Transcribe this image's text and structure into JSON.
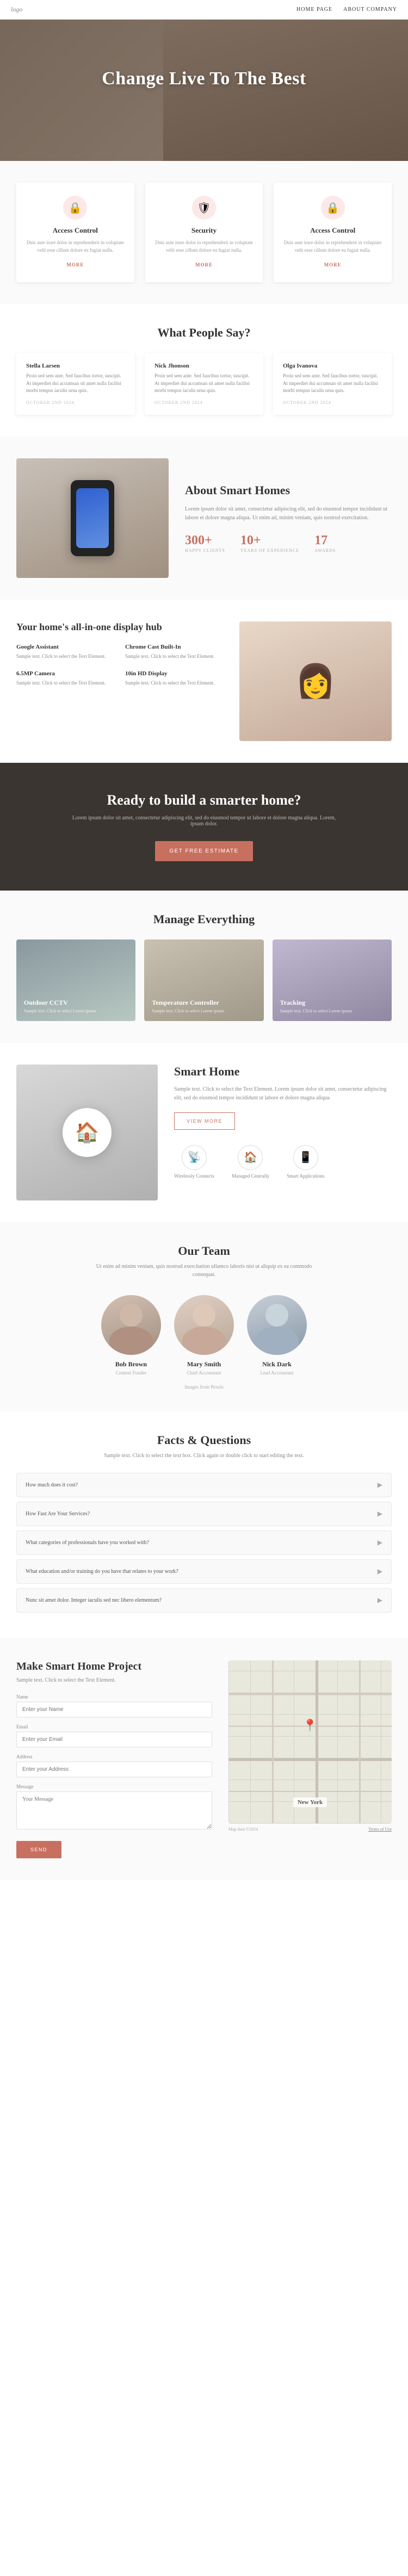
{
  "nav": {
    "logo": "logo",
    "links": [
      "HOME PAGE",
      "ABOUT COMPANY"
    ]
  },
  "hero": {
    "title": "Change Live To The Best"
  },
  "features": [
    {
      "icon": "🔒",
      "title": "Access Control",
      "description": "Duis aute irure dolor in reprehenderit in voluptate velit esse cillum dolore eu fugiat nulla.",
      "more": "MORE"
    },
    {
      "icon": "🛡️",
      "title": "Security",
      "description": "Duis aute irure dolor in reprehenderit in voluptate velit esse cillum dolore eu fugiat nulla.",
      "more": "MORE"
    },
    {
      "icon": "🔒",
      "title": "Access Control",
      "description": "Duis aute irure dolor in reprehenderit in voluptate velit esse cillum dolore eu fugiat nulla.",
      "more": "MORE"
    }
  ],
  "testimonials": {
    "section_title": "What People Say?",
    "items": [
      {
        "name": "Stella Larsen",
        "text": "Proin sed sem ante. Sed faucibus tortor, suscipit. At imperdiet dui accumsan sit amet nulla facilisi morbi tempus iaculis urna quis.",
        "date": "OCTOBER 2ND 2024"
      },
      {
        "name": "Nick Jhonson",
        "text": "Proin sed sem ante. Sed faucibus tortor, suscipit. At imperdiet dui accumsan sit amet nulla facilisi morbi tempus iaculis urna quis.",
        "date": "OCTOBER 2ND 2024"
      },
      {
        "name": "Olga Ivanova",
        "text": "Proin sed sem ante. Sed faucibus tortor, suscipit. At imperdiet dui accumsan sit amet nulla facilisi morbi tempus iaculis urna quis.",
        "date": "OCTOBER 2ND 2024"
      }
    ]
  },
  "about": {
    "title": "About Smart Homes",
    "description": "Lorem ipsum dolor sit amet, consectetur adipiscing elit, sed do eiusmod tempor incididunt ut labore et dolore magna aliqua. Ut enim ad, minim veniam, quis nostrud exercitation.",
    "stats": [
      {
        "number": "300+",
        "label": "HAPPY CLIENTS"
      },
      {
        "number": "10+",
        "label": "YEARS OF EXPERIENCE"
      },
      {
        "number": "17",
        "label": "AWARDS"
      }
    ]
  },
  "hub": {
    "title": "Your home's all-in-one display hub",
    "items": [
      {
        "title": "Google Assistant",
        "description": "Sample text. Click to select the Text Element."
      },
      {
        "title": "Chrome Cast Built-In",
        "description": "Sample text. Click to select the Text Element."
      },
      {
        "title": "6.5MP Camera",
        "description": "Sample text. Click to select the Text Element."
      },
      {
        "title": "10in HD Display",
        "description": "Sample text. Click to select the Text Element."
      }
    ]
  },
  "cta": {
    "title": "Ready to build a smarter home?",
    "description": "Lorem ipsum dolor sit amet, consectetur adipiscing elit, sed do eiusmod tempor ut labore et dolore magna aliqua. Lorem, ipsum dolor.",
    "button": "GET FREE ESTIMATE"
  },
  "manage": {
    "section_title": "Manage Everything",
    "items": [
      {
        "label": "Outdoor CCTV",
        "description": "Sample text. Click to select Lorem ipsum"
      },
      {
        "label": "Temperature Controller",
        "description": "Sample text. Click to select Lorem ipsum"
      },
      {
        "label": "Tracking",
        "description": "Sample text. Click to select Lorem ipsum"
      }
    ]
  },
  "smart": {
    "title": "Smart Home",
    "description": "Sample text. Click to select the Text Element. Lorem ipsum dolor sit amet, consectetur adipiscing elit, sed do eiusmod tempor incididunt ut labore et dolore magna aliqua.",
    "button": "VIEW MORE",
    "icons": [
      {
        "icon": "📡",
        "label": "Wirelessly Connects"
      },
      {
        "icon": "🏠",
        "label": "Managed Centrally"
      },
      {
        "icon": "📱",
        "label": "Smart Applications"
      }
    ]
  },
  "team": {
    "section_title": "Our Team",
    "subtitle": "Ut enim ad minim veniam, quis nostrud exercitation ullamco laboris nisi ut aliquip ex ea commodo consequat.",
    "members": [
      {
        "name": "Bob Brown",
        "role": "Content Funder"
      },
      {
        "name": "Mary Smith",
        "role": "Chief Accountant"
      },
      {
        "name": "Nick Dark",
        "role": "Lead Accountant"
      }
    ],
    "credit": "Images from Pexels"
  },
  "faq": {
    "section_title": "Facts & Questions",
    "subtitle": "Sample text. Click to select the text box. Click again or double click to start editing the text.",
    "items": [
      {
        "question": "How much does it cost?"
      },
      {
        "question": "How Fast Are Your Services?"
      },
      {
        "question": "What categories of professionals have you worked with?"
      },
      {
        "question": "What education and/or training do you have that relates to your work?"
      },
      {
        "question": "Nunc sit amet dolor. Integer iaculis sed nec libero elementum?"
      }
    ]
  },
  "contact": {
    "title": "Make Smart Home Project",
    "description": "Sample text. Click to select the Text Element.",
    "form": {
      "name_label": "Name",
      "name_placeholder": "Enter your Name",
      "email_label": "Email",
      "email_placeholder": "Enter your Email",
      "address_label": "Address",
      "address_placeholder": "Enter your Address",
      "message_label": "Message",
      "message_placeholder": "Your Message",
      "submit": "SEND"
    }
  },
  "map": {
    "label": "New York",
    "footer_left": "Map data ©2024",
    "footer_right": "Terms of Use"
  }
}
